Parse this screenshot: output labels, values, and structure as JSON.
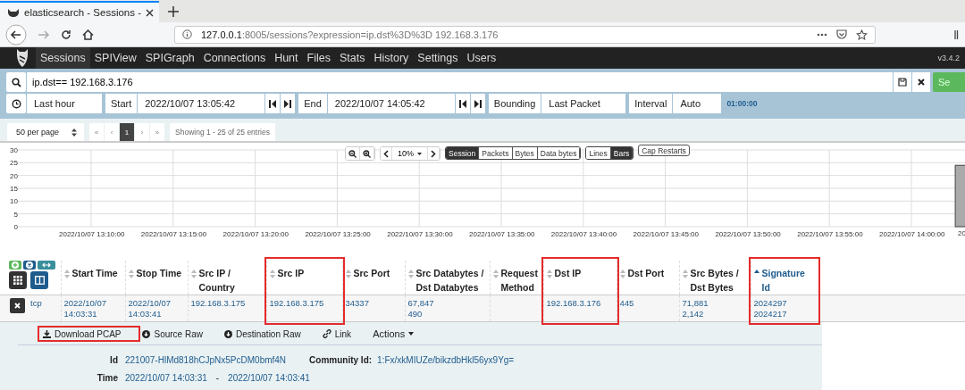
{
  "browser": {
    "tab_title": "elasticsearch - Sessions -",
    "url_host": "127.0.0.1",
    "url_rest": ":8005/sessions?expression=ip.dst%3D%3D 192.168.3.176"
  },
  "nav": {
    "items": [
      {
        "label": "Sessions",
        "selected": true
      },
      {
        "label": "SPIView",
        "selected": false
      },
      {
        "label": "SPIGraph",
        "selected": false
      },
      {
        "label": "Connections",
        "selected": false
      },
      {
        "label": "Hunt",
        "selected": false
      },
      {
        "label": "Files",
        "selected": false
      },
      {
        "label": "Stats",
        "selected": false
      },
      {
        "label": "History",
        "selected": false
      },
      {
        "label": "Settings",
        "selected": false
      },
      {
        "label": "Users",
        "selected": false
      }
    ],
    "version": "v3.4.2"
  },
  "search": {
    "value": "ip.dst== 192.168.3.176",
    "button": "Se"
  },
  "time": {
    "range": "Last hour",
    "start_label": "Start",
    "start": "2022/10/07 13:05:42",
    "end_label": "End",
    "end": "2022/10/07 14:05:42",
    "bounding_label": "Bounding",
    "bounding": "Last Packet",
    "interval_label": "Interval",
    "interval": "Auto",
    "duration": "01:00:00"
  },
  "pagination": {
    "per_page": "50 per page",
    "pages": [
      {
        "label": "«",
        "selected": false
      },
      {
        "label": "‹",
        "selected": false
      },
      {
        "label": "1",
        "selected": true
      },
      {
        "label": "›",
        "selected": false
      },
      {
        "label": "»",
        "selected": false
      }
    ],
    "showing": "Showing 1 - 25 of 25 entries"
  },
  "chart_toolbar": {
    "zoom": "10%",
    "metrics": [
      {
        "label": "Session",
        "selected": true
      },
      {
        "label": "Packets",
        "selected": false
      },
      {
        "label": "Bytes",
        "selected": false
      },
      {
        "label": "Data bytes",
        "selected": false
      }
    ],
    "styles": [
      {
        "label": "Lines",
        "selected": false
      },
      {
        "label": "Bars",
        "selected": true
      }
    ],
    "cap_restarts": "Cap Restarts"
  },
  "chart_data": {
    "type": "bar",
    "grid": true,
    "ylim": [
      0,
      30
    ],
    "yticks": [
      0,
      5,
      10,
      15,
      20,
      25,
      30
    ],
    "categories": [
      null,
      null,
      null,
      null,
      "2022/10/07 13:10:00",
      null,
      null,
      null,
      null,
      "2022/10/07 13:15:00",
      null,
      null,
      null,
      null,
      "2022/10/07 13:20:00",
      null,
      null,
      null,
      null,
      "2022/10/07 13:25:00",
      null,
      null,
      null,
      null,
      "2022/10/07 13:30:00",
      null,
      null,
      null,
      null,
      "2022/10/07 13:35:00",
      null,
      null,
      null,
      null,
      "2022/10/07 13:40:00",
      null,
      null,
      null,
      null,
      "2022/10/07 13:45:00",
      null,
      null,
      null,
      null,
      "2022/10/07 13:50:00",
      null,
      null,
      null,
      null,
      "2022/10/07 13:55:00",
      null,
      null,
      null,
      null,
      "2022/10/07 14:00:00",
      null,
      null,
      null
    ],
    "values": [
      null,
      null,
      null,
      null,
      null,
      null,
      null,
      null,
      null,
      null,
      null,
      null,
      null,
      null,
      null,
      null,
      null,
      null,
      null,
      null,
      null,
      null,
      null,
      null,
      null,
      null,
      null,
      null,
      null,
      null,
      null,
      null,
      null,
      null,
      null,
      null,
      null,
      null,
      null,
      null,
      null,
      null,
      null,
      null,
      null,
      null,
      null,
      null,
      null,
      null,
      null,
      null,
      null,
      null,
      null,
      null,
      null,
      24
    ]
  },
  "chart_edge_label": "20",
  "table": {
    "columns": [
      {
        "label": "Start Time",
        "sorted": false,
        "highlighted": false
      },
      {
        "label": "Stop Time",
        "sorted": false,
        "highlighted": false
      },
      {
        "label": "Src IP / Country",
        "sorted": false,
        "highlighted": false
      },
      {
        "label": "Src IP",
        "sorted": false,
        "highlighted": true
      },
      {
        "label": "Src Port",
        "sorted": false,
        "highlighted": false
      },
      {
        "label": "Src Databytes / Dst Databytes",
        "sorted": false,
        "highlighted": false
      },
      {
        "label": "Request Method",
        "sorted": false,
        "highlighted": false
      },
      {
        "label": "Dst IP",
        "sorted": false,
        "highlighted": true
      },
      {
        "label": "Dst Port",
        "sorted": false,
        "highlighted": false
      },
      {
        "label": "Src Bytes / Dst Bytes",
        "sorted": false,
        "highlighted": false
      },
      {
        "label": "Signature Id",
        "sorted": true,
        "highlighted": true
      }
    ],
    "rows": [
      {
        "protocol": "tcp",
        "cells": [
          [
            "2022/10/07",
            "14:03:31"
          ],
          [
            "2022/10/07",
            "14:03:41"
          ],
          [
            "192.168.3.175"
          ],
          [
            "192.168.3.175"
          ],
          [
            "34337"
          ],
          [
            "67,847",
            "490"
          ],
          [],
          [
            "192.168.3.176"
          ],
          [
            "445"
          ],
          [
            "71,881",
            "2,142"
          ],
          [
            "2024297",
            "2024217"
          ]
        ]
      }
    ]
  },
  "detail": {
    "actions": [
      {
        "label": "Download PCAP",
        "kind": "download",
        "highlighted": true
      },
      {
        "label": "Source Raw",
        "kind": "source",
        "highlighted": false
      },
      {
        "label": "Destination Raw",
        "kind": "destination",
        "highlighted": false
      },
      {
        "label": "Link",
        "kind": "link",
        "highlighted": false
      },
      {
        "label": "Actions",
        "kind": "menu",
        "highlighted": false
      }
    ],
    "id_label": "Id",
    "id": "221007-HlMd818hCJpNx5PcDM0bmf4N",
    "community_label": "Community Id:",
    "community": "1:Fx/xkMIUZe/bikzdbHkl56yx9Yg=",
    "time_label": "Time",
    "time_start": "2022/10/07 14:03:31",
    "time_sep": "-",
    "time_end": "2022/10/07 14:03:41"
  }
}
